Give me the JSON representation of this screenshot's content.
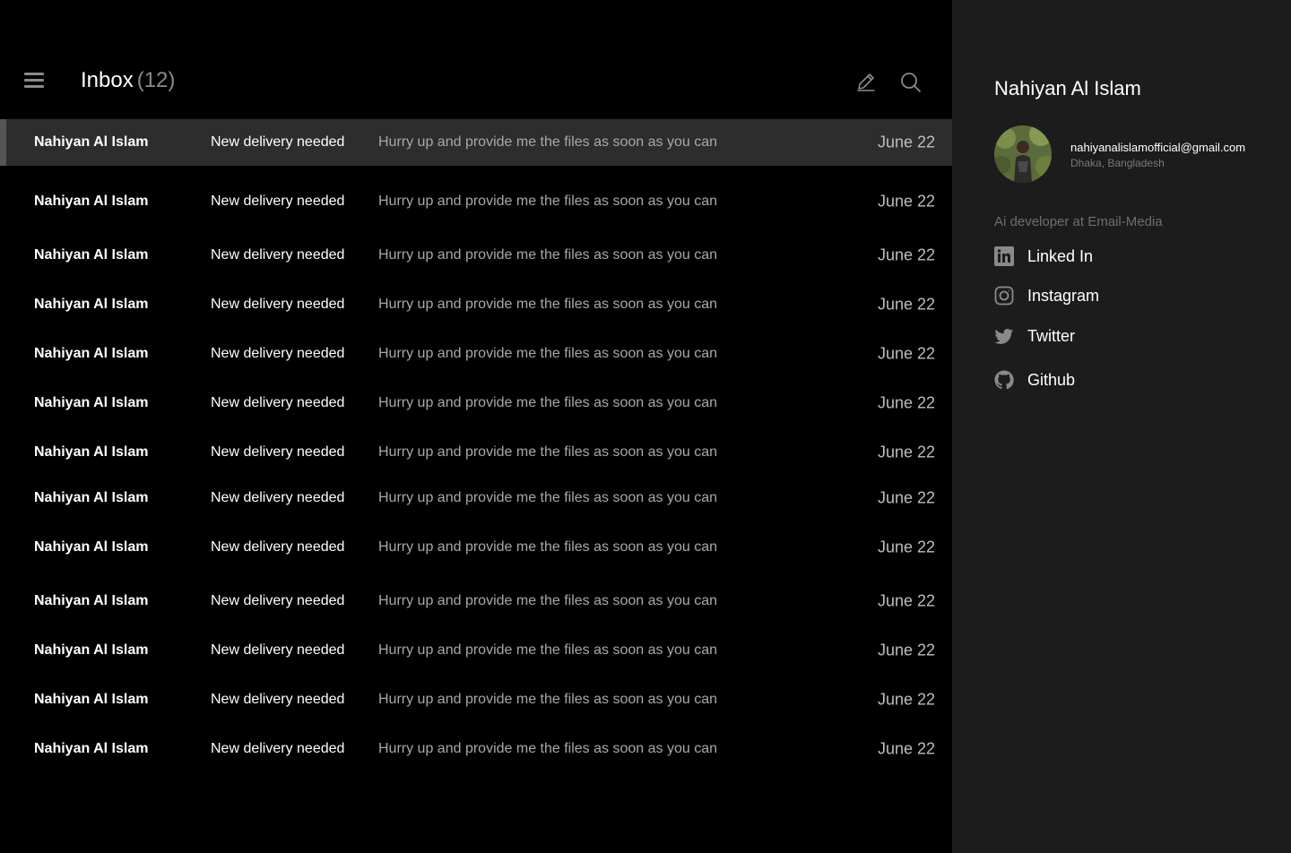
{
  "header": {
    "title": "Inbox",
    "count": "(12)",
    "menu_icon": "hamburger-menu-icon",
    "compose_icon": "pencil-icon",
    "search_icon": "search-icon"
  },
  "emails": [
    {
      "sender": "Nahiyan Al Islam",
      "subject": "New delivery needed",
      "preview": "Hurry up and provide me the files as soon as you can",
      "date": "June 22",
      "selected": true
    },
    {
      "sender": "Nahiyan Al Islam",
      "subject": "New delivery needed",
      "preview": "Hurry up and provide me the files as soon as you can",
      "date": "June 22"
    },
    {
      "sender": "Nahiyan Al Islam",
      "subject": "New delivery needed",
      "preview": "Hurry up and provide me the files as soon as you can",
      "date": "June 22"
    },
    {
      "sender": "Nahiyan Al Islam",
      "subject": "New delivery needed",
      "preview": "Hurry up and provide me the files as soon as you can",
      "date": "June 22"
    },
    {
      "sender": "Nahiyan Al Islam",
      "subject": "New delivery needed",
      "preview": "Hurry up and provide me the files as soon as you can",
      "date": "June 22"
    },
    {
      "sender": "Nahiyan Al Islam",
      "subject": "New delivery needed",
      "preview": "Hurry up and provide me the files as soon as you can",
      "date": "June 22"
    },
    {
      "sender": "Nahiyan Al Islam",
      "subject": "New delivery needed",
      "preview": "Hurry up and provide me the files as soon as you can",
      "date": "June 22"
    },
    {
      "sender": "Nahiyan Al Islam",
      "subject": "New delivery needed",
      "preview": "Hurry up and provide me the files as soon as you can",
      "date": "June 22"
    },
    {
      "sender": "Nahiyan Al Islam",
      "subject": "New delivery needed",
      "preview": "Hurry up and provide me the files as soon as you can",
      "date": "June 22"
    },
    {
      "sender": "Nahiyan Al Islam",
      "subject": "New delivery needed",
      "preview": "Hurry up and provide me the files as soon as you can",
      "date": "June 22"
    },
    {
      "sender": "Nahiyan Al Islam",
      "subject": "New delivery needed",
      "preview": "Hurry up and provide me the files as soon as you can",
      "date": "June 22"
    },
    {
      "sender": "Nahiyan Al Islam",
      "subject": "New delivery needed",
      "preview": "Hurry up and provide me the files as soon as you can",
      "date": "June 22"
    },
    {
      "sender": "Nahiyan Al Islam",
      "subject": "New delivery needed",
      "preview": "Hurry up and provide me the files as soon as you can",
      "date": "June 22"
    }
  ],
  "profile": {
    "name": "Nahiyan Al Islam",
    "email": "nahiyanalislamofficial@gmail.com",
    "location": "Dhaka, Bangladesh",
    "role": "Ai developer at Email-Media",
    "socials": [
      {
        "label": "Linked In",
        "icon": "linkedin-icon"
      },
      {
        "label": "Instagram",
        "icon": "instagram-icon"
      },
      {
        "label": "Twitter",
        "icon": "twitter-icon"
      },
      {
        "label": "Github",
        "icon": "github-icon"
      }
    ]
  },
  "colors": {
    "background": "#000000",
    "sidebar": "#1c1c1c",
    "selected_row": "#2d2d2d",
    "muted_text": "#8a8a8a"
  }
}
